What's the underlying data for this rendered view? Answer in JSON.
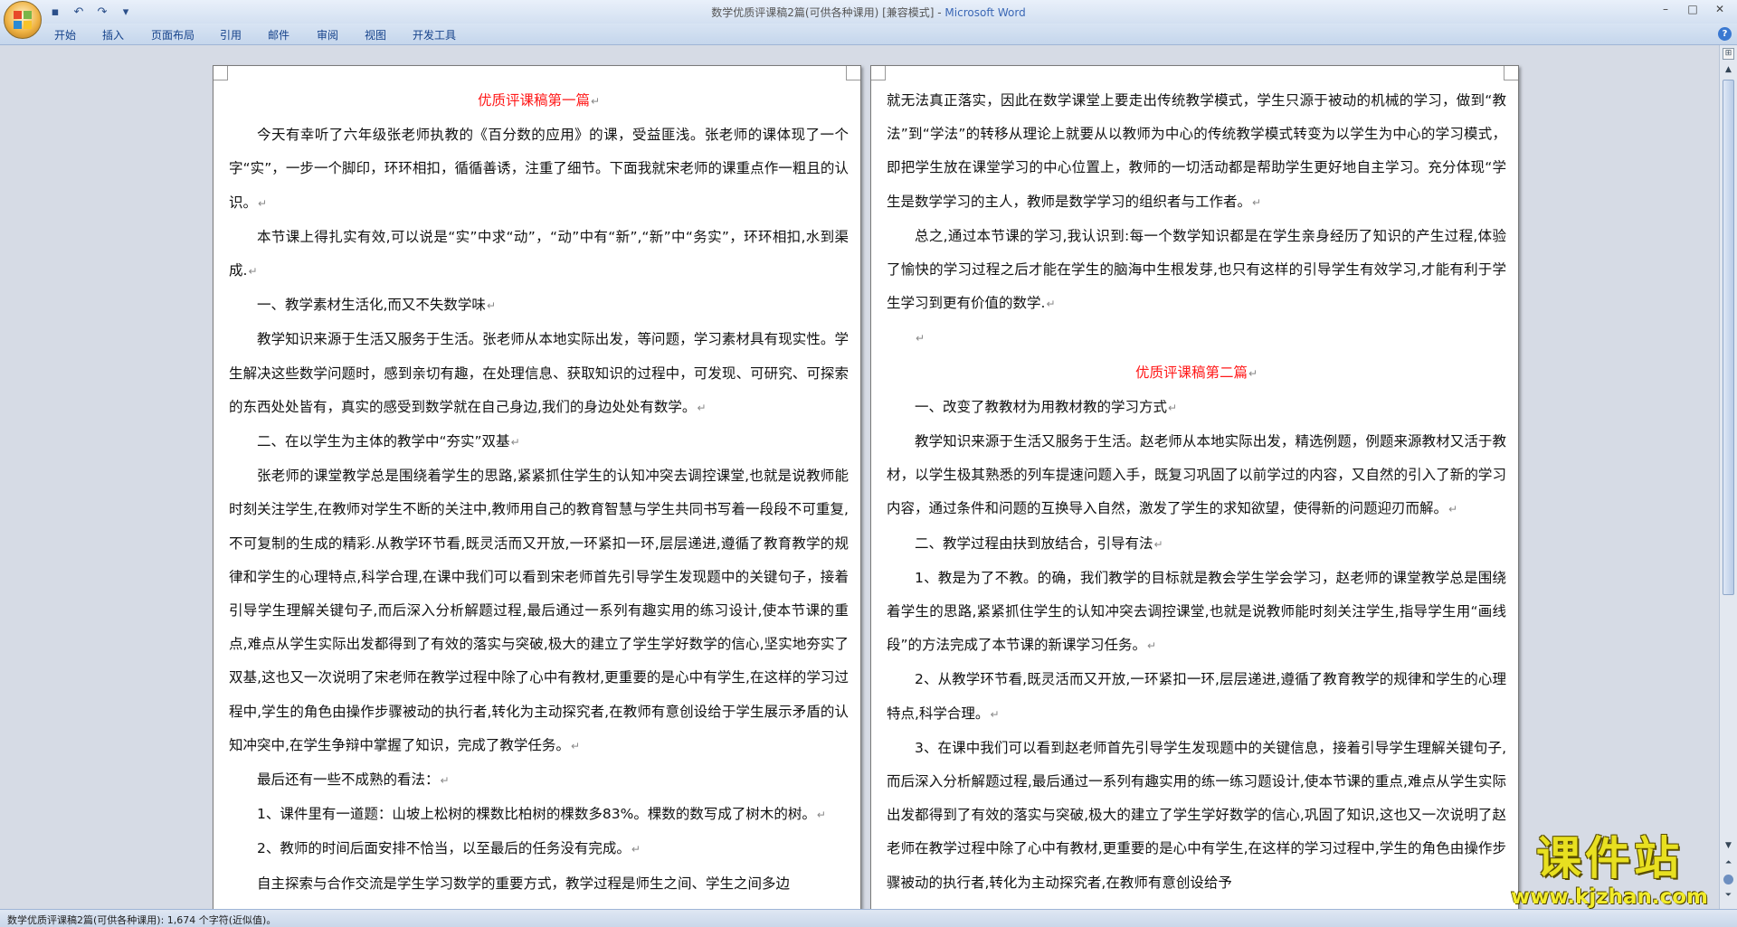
{
  "window": {
    "title": "数学优质评课稿2篇(可供各种课用) [兼容模式] - ",
    "app_name": "Microsoft Word"
  },
  "quick_access": {
    "save_icon": "save-icon",
    "undo_icon": "undo-icon",
    "redo_icon": "redo-icon",
    "customize_icon": "dropdown-icon"
  },
  "tabs": [
    "开始",
    "插入",
    "页面布局",
    "引用",
    "邮件",
    "审阅",
    "视图",
    "开发工具"
  ],
  "office_logo_colors": [
    "#e84a2a",
    "#7ab648",
    "#2a8ad4",
    "#f7c32a"
  ],
  "page1": {
    "title": "优质评课稿第一篇",
    "paragraphs": [
      "今天有幸听了六年级张老师执教的《百分数的应用》的课，受益匪浅。张老师的课体现了一个字“实”，一步一个脚印，环环相扣，循循善诱，注重了细节。下面我就宋老师的课重点作一粗且的认识。",
      "本节课上得扎实有效,可以说是“实”中求“动”，“动”中有“新”,“新”中“务实”，环环相扣,水到渠成.",
      "一、教学素材生活化,而又不失数学味",
      "教学知识来源于生活又服务于生活。张老师从本地实际出发，等问题，学习素材具有现实性。学生解决这些数学问题时，感到亲切有趣，在处理信息、获取知识的过程中，可发现、可研究、可探索的东西处处皆有，真实的感受到数学就在自己身边,我们的身边处处有数学。",
      "二、在以学生为主体的教学中“夯实”双基",
      "张老师的课堂教学总是围绕着学生的思路,紧紧抓住学生的认知冲突去调控课堂,也就是说教师能时刻关注学生,在教师对学生不断的关注中,教师用自己的教育智慧与学生共同书写着一段段不可重复,不可复制的生成的精彩.从教学环节看,既灵活而又开放,一环紧扣一环,层层递进,遵循了教育教学的规律和学生的心理特点,科学合理,在课中我们可以看到宋老师首先引导学生发现题中的关键句子，接着引导学生理解关键句子,而后深入分析解题过程,最后通过一系列有趣实用的练习设计,使本节课的重点,难点从学生实际出发都得到了有效的落实与突破,极大的建立了学生学好数学的信心,坚实地夯实了双基,这也又一次说明了宋老师在教学过程中除了心中有教材,更重要的是心中有学生,在这样的学习过程中,学生的角色由操作步骤被动的执行者,转化为主动探究者,在教师有意创设给于学生展示矛盾的认知冲突中,在学生争辩中掌握了知识，完成了教学任务。",
      "最后还有一些不成熟的看法：",
      "1、课件里有一道题：山坡上松树的棵数比柏树的棵数多83%。棵数的数写成了树木的树。",
      "2、教师的时间后面安排不恰当，以至最后的任务没有完成。",
      "自主探索与合作交流是学生学习数学的重要方式，教学过程是师生之间、学生之间多边"
    ]
  },
  "page2": {
    "continued": "就无法真正落实，因此在数学课堂上要走出传统教学模式，学生只源于被动的机械的学习，做到“教法”到“学法”的转移从理论上就要从以教师为中心的传统教学模式转变为以学生为中心的学习模式，即把学生放在课堂学习的中心位置上，教师的一切活动都是帮助学生更好地自主学习。充分体现“学生是数学学习的主人，教师是数学学习的组织者与工作者。",
    "summary": "总之,通过本节课的学习,我认识到:每一个数学知识都是在学生亲身经历了知识的产生过程,体验了愉快的学习过程之后才能在学生的脑海中生根发芽,也只有这样的引导学生有效学习,才能有利于学生学习到更有价值的数学.",
    "title": "优质评课稿第二篇",
    "paragraphs": [
      "一、改变了教教材为用教材教的学习方式",
      "教学知识来源于生活又服务于生活。赵老师从本地实际出发，精选例题，例题来源教材又活于教材，以学生极其熟悉的列车提速问题入手，既复习巩固了以前学过的内容，又自然的引入了新的学习内容，通过条件和问题的互换导入自然，激发了学生的求知欲望，使得新的问题迎刃而解。",
      "二、教学过程由扶到放结合，引导有法",
      "1、教是为了不教。的确，我们教学的目标就是教会学生学会学习，赵老师的课堂教学总是围绕着学生的思路,紧紧抓住学生的认知冲突去调控课堂,也就是说教师能时刻关注学生,指导学生用“画线段”的方法完成了本节课的新课学习任务。",
      "2、从教学环节看,既灵活而又开放,一环紧扣一环,层层递进,遵循了教育教学的规律和学生的心理特点,科学合理。",
      "3、在课中我们可以看到赵老师首先引导学生发现题中的关键信息，接着引导学生理解关键句子,而后深入分析解题过程,最后通过一系列有趣实用的练一练习题设计,使本节课的重点,难点从学生实际出发都得到了有效的落实与突破,极大的建立了学生学好数学的信心,巩固了知识,这也又一次说明了赵老师在教学过程中除了心中有教材,更重要的是心中有学生,在这样的学习过程中,学生的角色由操作步骤被动的执行者,转化为主动探究者,在教师有意创设给予"
    ]
  },
  "para_mark": "↵",
  "status": {
    "text": "数学优质评课稿2篇(可供各种课用): 1,674 个字符(近似值)。"
  },
  "scrollbar": {
    "ruler_icon": "ruler-icon",
    "up_icon": "scroll-up-icon",
    "down_icon": "scroll-down-icon"
  },
  "watermark": {
    "title": "课件站",
    "url": "www.kjzhan.com"
  },
  "colors": {
    "heading_red": "#ff1a1a",
    "app_blue": "#3a67b5",
    "tab_text": "#15428b"
  }
}
